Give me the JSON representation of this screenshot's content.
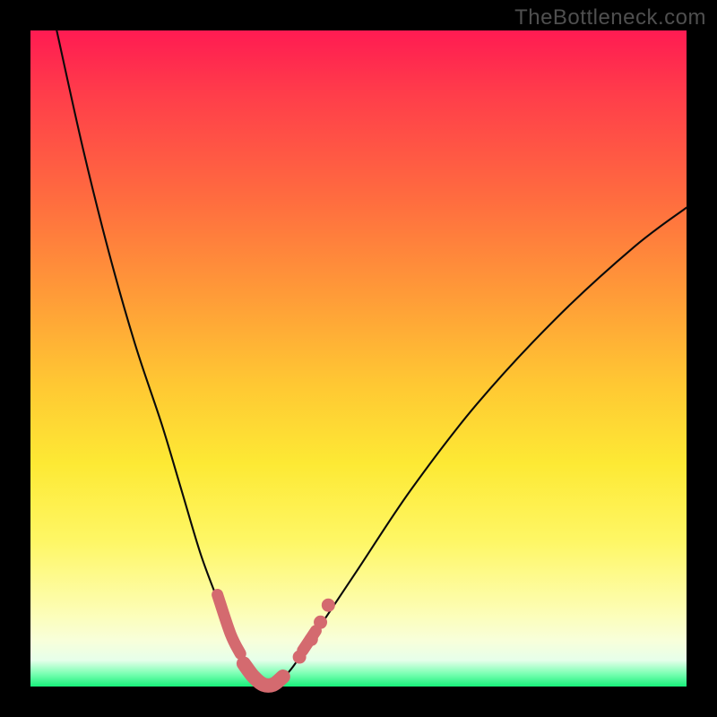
{
  "watermark": "TheBottleneck.com",
  "chart_data": {
    "type": "line",
    "title": "",
    "xlabel": "",
    "ylabel": "",
    "xlim": [
      0,
      100
    ],
    "ylim": [
      0,
      100
    ],
    "series": [
      {
        "name": "bottleneck-curve",
        "x": [
          4,
          8,
          12,
          16,
          20,
          23,
          26,
          29,
          30.5,
          32,
          33.5,
          35,
          36.5,
          38,
          40,
          44,
          50,
          58,
          68,
          80,
          92,
          100
        ],
        "y": [
          100,
          82,
          66,
          52,
          40,
          30,
          20,
          12,
          8,
          5,
          2.5,
          1,
          0.5,
          1,
          3,
          9,
          18,
          30,
          43,
          56,
          67,
          73
        ]
      }
    ],
    "highlight_segments": {
      "name": "highlighted-range-on-curve",
      "color": "#d46a6f",
      "segments": [
        {
          "x": [
            28.5,
            30.5,
            32
          ],
          "y": [
            14,
            8,
            5
          ]
        },
        {
          "x": [
            32.5,
            34,
            35.5,
            37,
            38.5
          ],
          "y": [
            3.5,
            1.5,
            0.3,
            0.3,
            1.5
          ]
        },
        {
          "x": [
            41.5,
            43.5
          ],
          "y": [
            5.5,
            8.5
          ]
        }
      ],
      "dots": [
        {
          "x": 41.0,
          "y": 4.5
        },
        {
          "x": 42.8,
          "y": 7.2
        },
        {
          "x": 44.2,
          "y": 9.8
        },
        {
          "x": 45.4,
          "y": 12.4
        }
      ]
    },
    "gradient_stops": [
      {
        "pos": 0,
        "color": "#ff1b52"
      },
      {
        "pos": 26,
        "color": "#ff6d3f"
      },
      {
        "pos": 54,
        "color": "#ffc833"
      },
      {
        "pos": 78,
        "color": "#fef766"
      },
      {
        "pos": 96,
        "color": "#e6ffea"
      },
      {
        "pos": 100,
        "color": "#17f07a"
      }
    ]
  }
}
